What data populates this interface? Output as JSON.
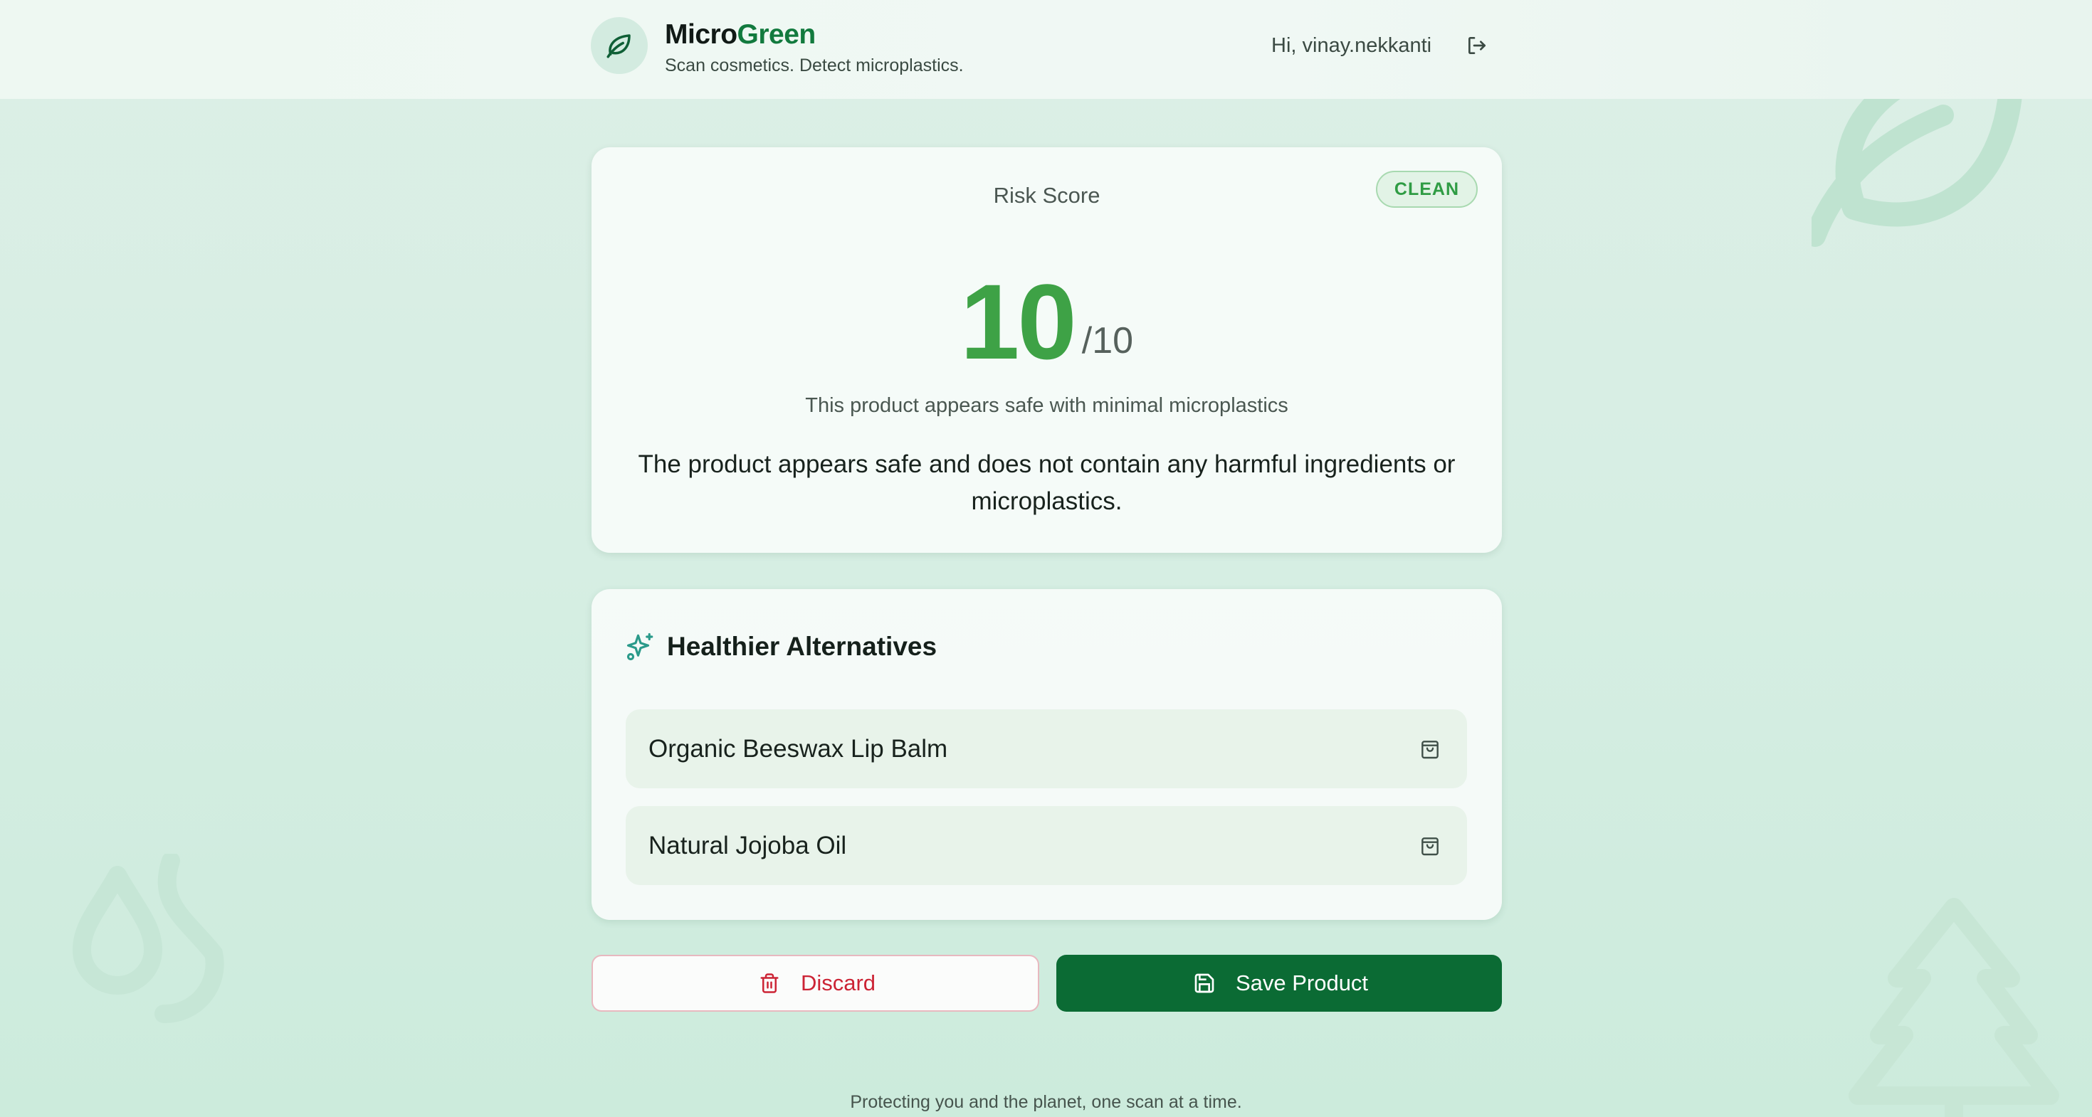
{
  "header": {
    "brand_part1": "Micro",
    "brand_part2": "Green",
    "tagline": "Scan cosmetics. Detect microplastics.",
    "greeting": "Hi, vinay.nekkanti",
    "logo_icon": "leaf-icon",
    "logout_icon": "logout-icon"
  },
  "risk": {
    "title": "Risk Score",
    "badge": "CLEAN",
    "score": "10",
    "max": "/10",
    "verdict": "This product appears safe with minimal microplastics",
    "summary": "The product appears safe and does not contain any harmful ingredients or microplastics."
  },
  "alternatives": {
    "title": "Healthier Alternatives",
    "icon": "sparkles-icon",
    "items": [
      {
        "name": "Organic Beeswax Lip Balm",
        "icon": "shopping-bag-icon"
      },
      {
        "name": "Natural Jojoba Oil",
        "icon": "shopping-bag-icon"
      }
    ]
  },
  "actions": {
    "discard_label": "Discard",
    "discard_icon": "trash-icon",
    "save_label": "Save Product",
    "save_icon": "save-icon"
  },
  "footer": {
    "text": "Protecting you and the planet, one scan at a time."
  },
  "colors": {
    "brand_green": "#127a3e",
    "score_green": "#3ea246",
    "save_button": "#0b6b34",
    "discard_red": "#cc2435",
    "badge_bg": "#e2f3e6"
  }
}
